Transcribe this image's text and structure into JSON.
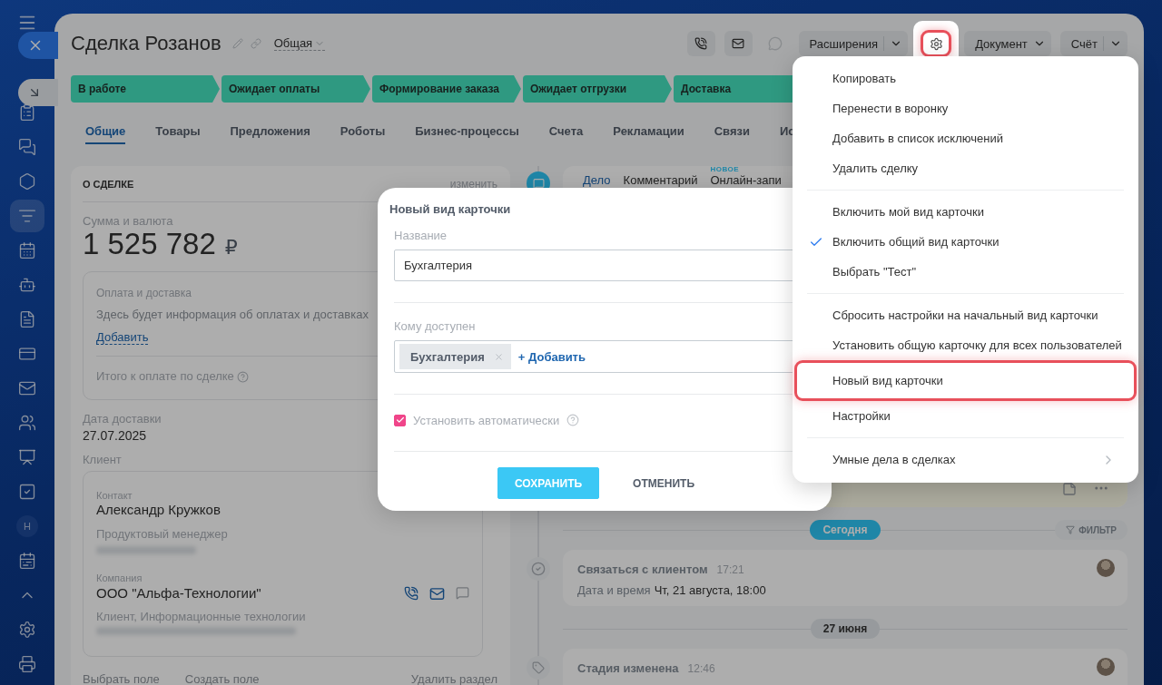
{
  "sidebar": {
    "items": [
      {
        "kind": "clipboard",
        "selected": false
      },
      {
        "kind": "chats",
        "selected": false
      },
      {
        "kind": "hexagon",
        "selected": false
      },
      {
        "kind": "funnel",
        "selected": true
      },
      {
        "kind": "calendar",
        "selected": false
      },
      {
        "kind": "robot",
        "selected": false
      },
      {
        "kind": "file",
        "selected": false
      },
      {
        "kind": "card",
        "selected": false
      },
      {
        "kind": "mail",
        "selected": false
      },
      {
        "kind": "users",
        "selected": false
      },
      {
        "kind": "board",
        "selected": false
      },
      {
        "kind": "check",
        "selected": false
      },
      {
        "kind": "avatar",
        "label": "Н",
        "selected": false
      },
      {
        "kind": "planner",
        "selected": false
      },
      {
        "kind": "chevron",
        "selected": false
      },
      {
        "kind": "gear",
        "selected": false
      },
      {
        "kind": "printer",
        "selected": false
      }
    ]
  },
  "header": {
    "title": "Сделка Розанов",
    "view": "Общая",
    "actions": [
      {
        "kind": "phone",
        "disabled": false
      },
      {
        "kind": "mail",
        "disabled": false
      },
      {
        "kind": "chat",
        "disabled": true
      },
      {
        "kind": "split",
        "label": "Расширения",
        "disabled": false
      },
      {
        "kind": "gear",
        "disabled": false,
        "highlighted": true
      },
      {
        "kind": "dropdown",
        "label": "Документ",
        "disabled": false
      },
      {
        "kind": "split",
        "label": "Счёт",
        "disabled": false
      }
    ]
  },
  "stages": [
    {
      "label": "В работе"
    },
    {
      "label": "Ожидает оплаты"
    },
    {
      "label": "Формирование заказа"
    },
    {
      "label": "Ожидает отгрузки"
    },
    {
      "label": "Доставка"
    }
  ],
  "tabs": [
    {
      "label": "Общие",
      "selected": true
    },
    {
      "label": "Товары",
      "selected": false
    },
    {
      "label": "Предложения",
      "selected": false
    },
    {
      "label": "Роботы",
      "selected": false
    },
    {
      "label": "Бизнес-процессы",
      "selected": false
    },
    {
      "label": "Счета",
      "selected": false
    },
    {
      "label": "Рекламации",
      "selected": false
    },
    {
      "label": "Связи",
      "selected": false
    },
    {
      "label": "Ис",
      "selected": false
    }
  ],
  "deal_card": {
    "title": "О СДЕЛКЕ",
    "edit_link": "изменить",
    "amount_label": "Сумма и валюта",
    "amount": "1 525 782",
    "currency": "₽",
    "payment": {
      "title": "Оплата и доставка",
      "text": "Здесь будет информация об оплатах и доставках",
      "add_link": "Добавить",
      "total_label": "Итого к оплате по сделке"
    },
    "delivery_label": "Дата доставки",
    "delivery_date": "27.07.2025",
    "client_label": "Клиент",
    "client": {
      "contact_label": "Контакт",
      "contact_name": "Александр Кружков",
      "contact_role": "Продуктовый менеджер",
      "company_label": "Компания",
      "company_name": "ООО \"Альфа-Технологии\"",
      "company_info": "Клиент, Информационные технологии"
    },
    "footer_links": [
      "Выбрать поле",
      "Создать поле"
    ],
    "delete_link": "Удалить раздел"
  },
  "timeline": {
    "composer_tabs": [
      {
        "label": "Дело",
        "selected": true
      },
      {
        "label": "Комментарий",
        "selected": false
      },
      {
        "label": "Онлайн-запи",
        "selected": false,
        "badge": "НОВОЕ"
      }
    ],
    "filter": "ФИЛЬТР",
    "groups": [
      {
        "date": "Сегодня",
        "today": true,
        "events": [
          {
            "kind": "task",
            "title": "Связаться с клиентом",
            "time": "17:21",
            "detail_label": "Дата и время",
            "detail_value": "Чт, 21 августа, 18:00"
          }
        ]
      },
      {
        "date": "27 июня",
        "today": false,
        "events": [
          {
            "kind": "stage",
            "title": "Стадия изменена",
            "time": "12:46"
          }
        ]
      }
    ]
  },
  "modal": {
    "title": "Новый вид карточки",
    "name_label": "Название",
    "name_value": "Бухгалтерия",
    "access_label": "Кому доступен",
    "access_tags": [
      {
        "label": "Бухгалтерия"
      }
    ],
    "add_link": "+ Добавить",
    "auto": {
      "label": "Установить автоматически",
      "checked": true
    },
    "buttons": [
      {
        "kind": "primary",
        "label": "СОХРАНИТЬ"
      },
      {
        "kind": "secondary",
        "label": "ОТМЕНИТЬ"
      }
    ]
  },
  "menu": {
    "groups": [
      [
        {
          "label": "Копировать",
          "kind": "action",
          "checked": false,
          "highlighted": false
        },
        {
          "label": "Перенести в воронку",
          "kind": "action",
          "checked": false,
          "highlighted": false
        },
        {
          "label": "Добавить в список исключений",
          "kind": "action",
          "checked": false,
          "highlighted": false
        },
        {
          "label": "Удалить сделку",
          "kind": "action",
          "checked": false,
          "highlighted": false
        }
      ],
      [
        {
          "label": "Включить мой вид карточки",
          "kind": "action",
          "checked": false,
          "highlighted": false
        },
        {
          "label": "Включить общий вид карточки",
          "kind": "action",
          "checked": true,
          "highlighted": false
        },
        {
          "label": "Выбрать \"Тест\"",
          "kind": "action",
          "checked": false,
          "highlighted": false
        }
      ],
      [
        {
          "label": "Сбросить настройки на начальный вид карточки",
          "kind": "action",
          "checked": false,
          "highlighted": false
        },
        {
          "label": "Установить общую карточку для всех пользователей",
          "kind": "action",
          "checked": false,
          "highlighted": false
        },
        {
          "label": "Новый вид карточки",
          "kind": "action",
          "checked": false,
          "highlighted": true
        },
        {
          "label": "Настройки",
          "kind": "action",
          "checked": false,
          "highlighted": false
        }
      ],
      [
        {
          "label": "Умные дела в сделках",
          "kind": "submenu",
          "checked": false,
          "highlighted": false
        }
      ]
    ]
  }
}
